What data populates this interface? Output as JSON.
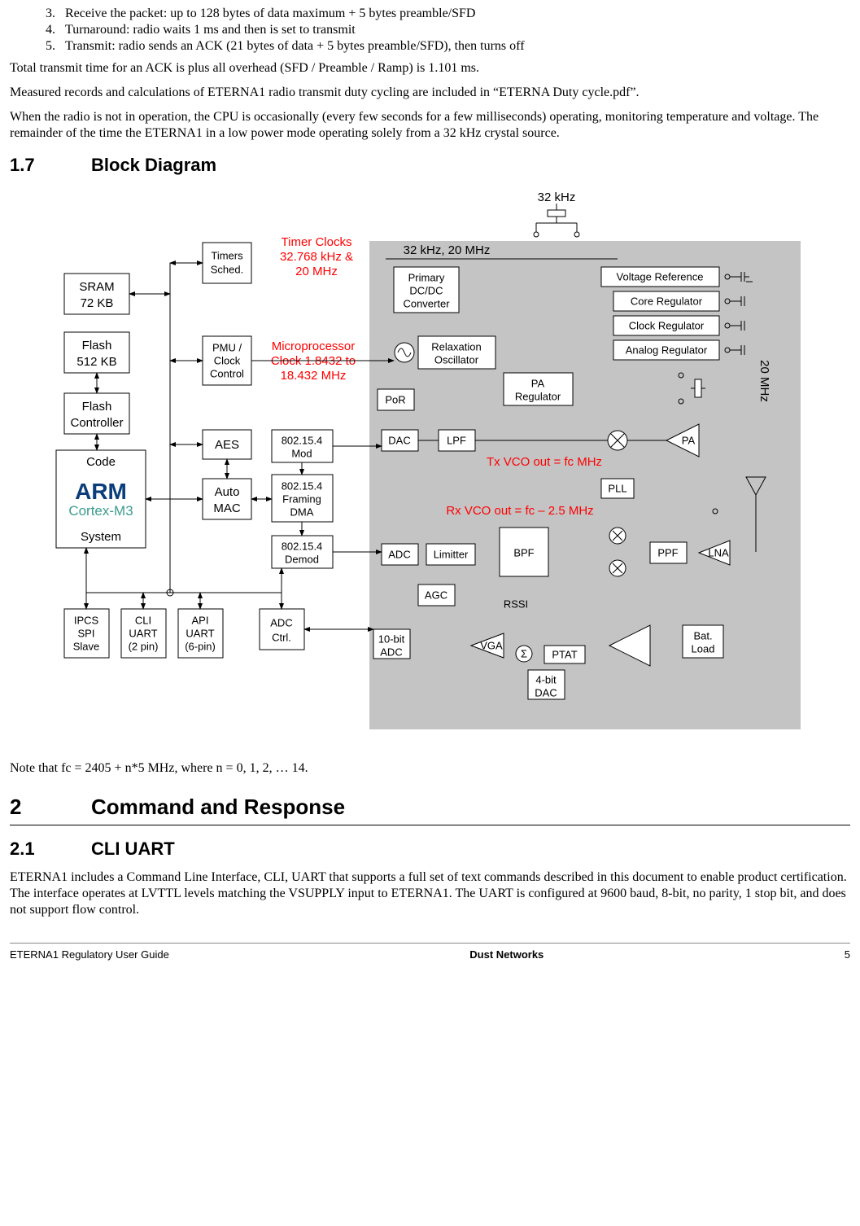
{
  "list": {
    "start": 3,
    "i3": "Receive the packet: up to 128 bytes of data maximum + 5 bytes preamble/SFD",
    "i4": "Turnaround: radio waits 1 ms and then is set to transmit",
    "i5": "Transmit: radio sends an ACK (21 bytes of data + 5 bytes preamble/SFD), then turns off"
  },
  "paras": {
    "p1": "Total transmit time for an ACK is plus all overhead (SFD / Preamble / Ramp) is 1.101 ms.",
    "p2": "Measured records and calculations of ETERNA1 radio transmit duty cycling are included in “ETERNA Duty cycle.pdf”.",
    "p3": "When the radio is not in operation, the CPU is occasionally (every few seconds for a few milliseconds) operating, monitoring temperature and voltage.  The remainder of the time the ETERNA1 in a low power mode operating solely from a 32 kHz crystal source.",
    "note": "Note that fc = 2405 + n*5 MHz, where n = 0, 1, 2, … 14.",
    "cli": "ETERNA1 includes a Command Line Interface, CLI, UART that supports a full set of text commands described in this document to enable product certification.  The interface operates at LVTTL levels matching the VSUPPLY input to ETERNA1.  The UART is configured at 9600 baud, 8-bit, no parity, 1 stop bit, and does not support flow control."
  },
  "headings": {
    "h17n": "1.7",
    "h17t": "Block Diagram",
    "h2n": "2",
    "h2t": "Command and Response",
    "h21n": "2.1",
    "h21t": "CLI UART"
  },
  "diagram": {
    "labels": {
      "khz32": "32 kHz",
      "clk_label": "32 kHz, 20 MHz",
      "timer_clocks_a": "Timer Clocks",
      "timer_clocks_b": "32.768 kHz &",
      "timer_clocks_c": "20 MHz",
      "micro_a": "Microprocessor",
      "micro_b": "Clock 1.8432 to",
      "micro_c": "18.432 MHz",
      "txvco": "Tx VCO out = fc MHz",
      "rxvco": "Rx VCO out = fc – 2.5 MHz",
      "mhz20": "20 MHz",
      "rssi": "RSSI"
    },
    "blocks": {
      "sram_a": "SRAM",
      "sram_b": "72 KB",
      "flash_a": "Flash",
      "flash_b": "512 KB",
      "flashc_a": "Flash",
      "flashc_b": "Controller",
      "code_a": "Code",
      "code_b": "ARM",
      "code_c": "Cortex-M3",
      "code_d": "System",
      "timers_a": "Timers",
      "timers_b": "Sched.",
      "pmu_a": "PMU /",
      "pmu_b": "Clock",
      "pmu_c": "Control",
      "aes": "AES",
      "automac_a": "Auto",
      "automac_b": "MAC",
      "mod_a": "802.15.4",
      "mod_b": "Mod",
      "frame_a": "802.15.4",
      "frame_b": "Framing",
      "frame_c": "DMA",
      "demod_a": "802.15.4",
      "demod_b": "Demod",
      "ipcs_a": "IPCS",
      "ipcs_b": "SPI",
      "ipcs_c": "Slave",
      "cliu_a": "CLI",
      "cliu_b": "UART",
      "cliu_c": "(2 pin)",
      "apiu_a": "API",
      "apiu_b": "UART",
      "apiu_c": "(6-pin)",
      "adcc_a": "ADC",
      "adcc_b": "Ctrl.",
      "primary_a": "Primary",
      "primary_b": "DC/DC",
      "primary_c": "Converter",
      "relax_a": "Relaxation",
      "relax_b": "Oscillator",
      "por": "PoR",
      "pareg_a": "PA",
      "pareg_b": "Regulator",
      "vref": "Voltage Reference",
      "coreg": "Core Regulator",
      "clkreg": "Clock Regulator",
      "anareg": "Analog Regulator",
      "dac": "DAC",
      "lpf": "LPF",
      "pa": "PA",
      "pll": "PLL",
      "adc": "ADC",
      "lim": "Limitter",
      "bpf": "BPF",
      "ppf": "PPF",
      "lna": "LNA",
      "agc": "AGC",
      "adc10_a": "10-bit",
      "adc10_b": "ADC",
      "vga": "VGA",
      "ptat": "PTAT",
      "dac4_a": "4-bit",
      "dac4_b": "DAC",
      "bat_a": "Bat.",
      "bat_b": "Load"
    }
  },
  "footer": {
    "left": "ETERNA1 Regulatory User Guide",
    "center": "Dust Networks",
    "right": "5"
  }
}
